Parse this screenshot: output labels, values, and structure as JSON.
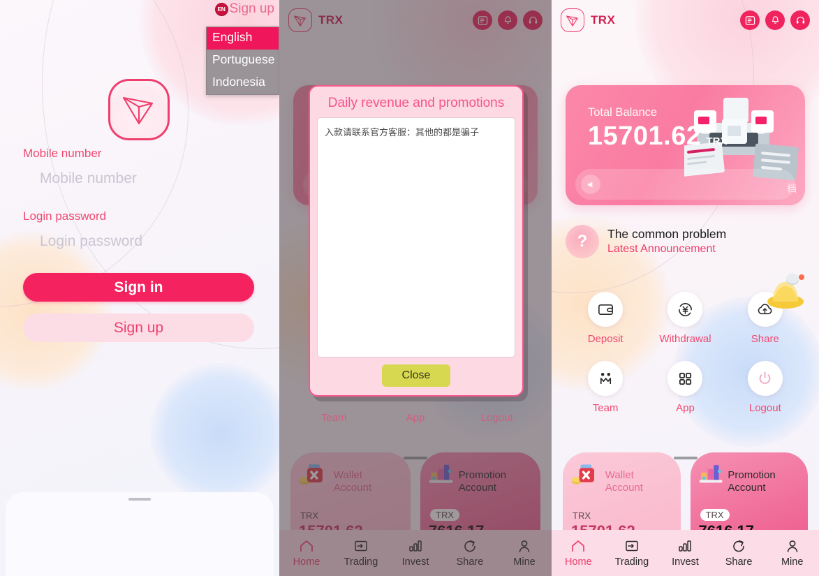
{
  "brand": {
    "accent": "#f0165c",
    "pink": "#ef3e6d",
    "name": "TRX",
    "token": "TRX"
  },
  "login": {
    "signup_top_label": "Sign up",
    "lang_badge": "EN",
    "languages": [
      {
        "label": "English",
        "selected": true
      },
      {
        "label": "Portuguese",
        "selected": false
      },
      {
        "label": "Indonesia",
        "selected": false
      }
    ],
    "mobile_label": "Mobile number",
    "mobile_placeholder": "Mobile number",
    "mobile_value": "",
    "password_label": "Login password",
    "password_placeholder": "Login password",
    "password_value": "",
    "signin_button": "Sign in",
    "signup_button": "Sign up"
  },
  "dialog": {
    "title": "Daily revenue and promotions",
    "body_text": "入款请联系官方客服：其他的都是骗子",
    "close_button": "Close"
  },
  "middle_labels": [
    "Team",
    "App",
    "Logout"
  ],
  "home": {
    "header_title": "TRX",
    "header_icons": [
      {
        "name": "news-icon"
      },
      {
        "name": "bell-icon"
      },
      {
        "name": "headset-icon"
      }
    ],
    "balance": {
      "label": "Total Balance",
      "amount": "15701.62",
      "unit": "TRX",
      "corner_text": "档"
    },
    "notice": {
      "title": "The common problem",
      "subtitle": "Latest Announcement",
      "mark": "?"
    },
    "actions": [
      {
        "label": "Deposit",
        "icon": "wallet-icon"
      },
      {
        "label": "Withdrawal",
        "icon": "yen-exchange-icon"
      },
      {
        "label": "Share",
        "icon": "cloud-share-icon"
      },
      {
        "label": "Team",
        "icon": "team-icon"
      },
      {
        "label": "App",
        "icon": "grid-icon"
      },
      {
        "label": "Logout",
        "icon": "power-icon"
      }
    ],
    "accounts": [
      {
        "name": "Wallet Account",
        "chip": "TRX",
        "value": "15701.62"
      },
      {
        "name": "Promotion Account",
        "chip": "TRX",
        "value": "7616.17"
      }
    ],
    "tabs": [
      {
        "label": "Home",
        "icon": "home-icon",
        "active": true
      },
      {
        "label": "Trading",
        "icon": "trading-icon",
        "active": false
      },
      {
        "label": "Invest",
        "icon": "invest-icon",
        "active": false
      },
      {
        "label": "Share",
        "icon": "share-icon",
        "active": false
      },
      {
        "label": "Mine",
        "icon": "person-icon",
        "active": false
      }
    ]
  }
}
